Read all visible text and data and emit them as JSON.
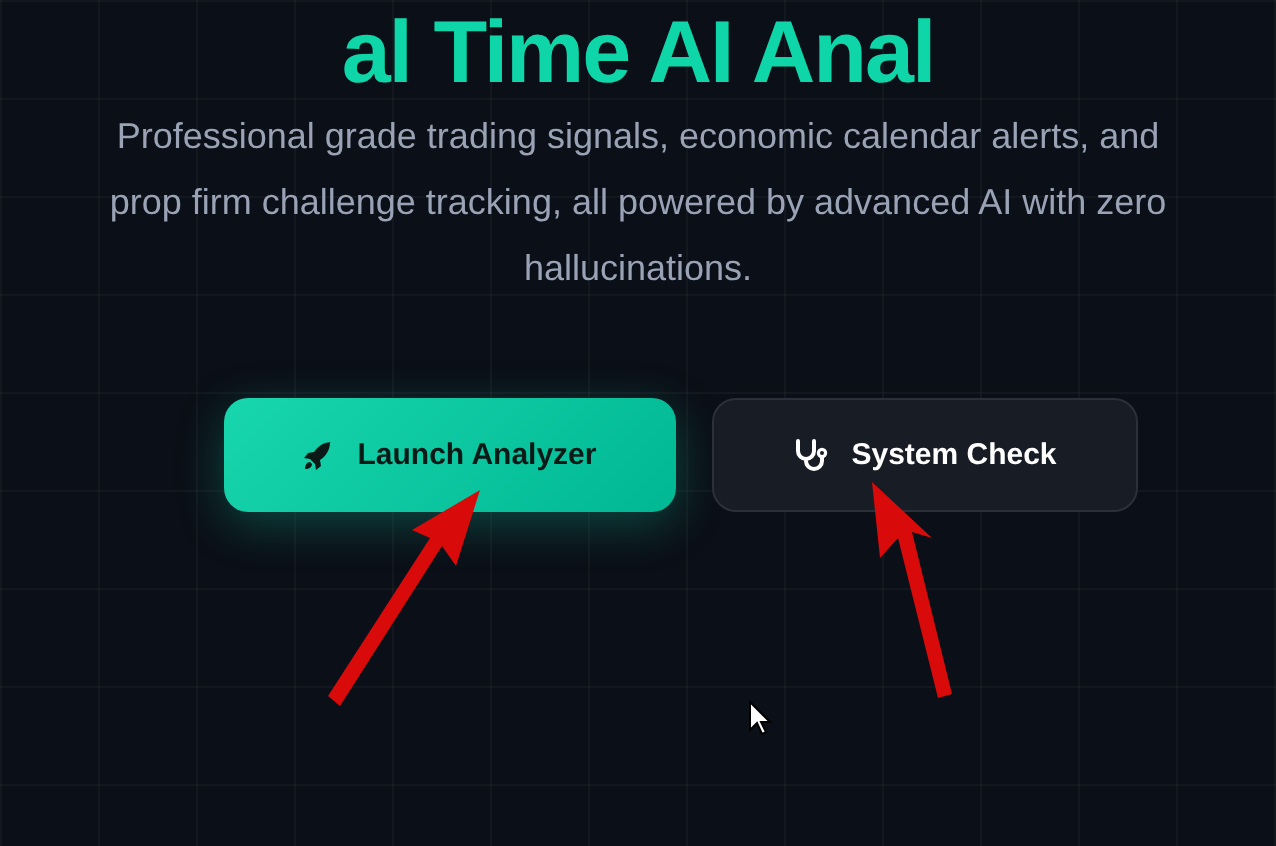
{
  "hero": {
    "heading": "al Time AI Anal",
    "description": "Professional grade trading signals, economic calendar alerts, and prop firm challenge tracking, all powered by advanced AI with zero hallucinations."
  },
  "buttons": [
    {
      "label": "Launch Analyzer",
      "kind": "primary"
    },
    {
      "label": "System Check",
      "kind": "secondary"
    }
  ],
  "annotations": [
    {
      "kind": "arrow"
    },
    {
      "kind": "arrow"
    }
  ]
}
